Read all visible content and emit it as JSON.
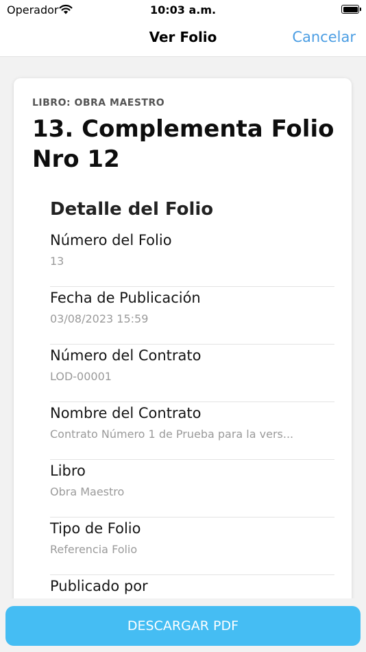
{
  "status_bar": {
    "carrier": "Operador",
    "time": "10:03 a.m."
  },
  "nav": {
    "title": "Ver Folio",
    "cancel_label": "Cancelar"
  },
  "card": {
    "book_label": "LIBRO: OBRA MAESTRO",
    "title": "13. Complementa Folio Nro 12",
    "section_title": "Detalle del Folio",
    "rows": [
      {
        "label": "Número del Folio",
        "value": "13"
      },
      {
        "label": "Fecha de Publicación",
        "value": "03/08/2023 15:59"
      },
      {
        "label": "Número del Contrato",
        "value": "LOD-00001"
      },
      {
        "label": "Nombre del Contrato",
        "value": "Contrato Número 1 de Prueba para la vers..."
      },
      {
        "label": "Libro",
        "value": "Obra Maestro"
      },
      {
        "label": "Tipo de Folio",
        "value": "Referencia Folio"
      },
      {
        "label": "Publicado por",
        "value": ""
      }
    ]
  },
  "download_label": "DESCARGAR PDF",
  "colors": {
    "accent": "#4a9de3",
    "button": "#45bdf3"
  }
}
